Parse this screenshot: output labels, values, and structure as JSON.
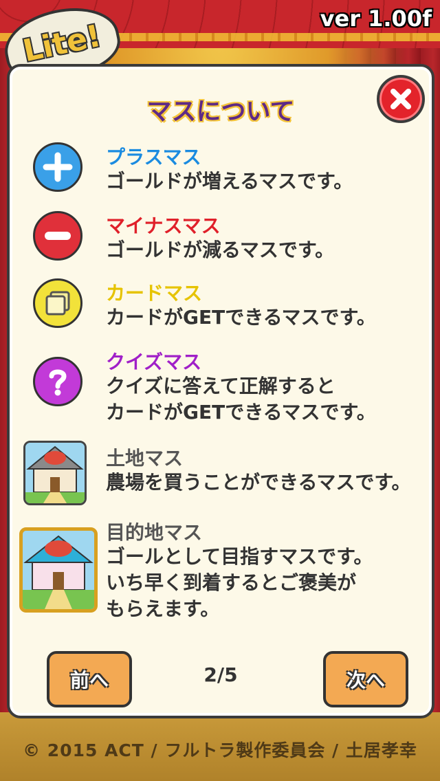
{
  "header": {
    "version": "ver 1.00f",
    "badge": "Lite!"
  },
  "panel": {
    "title": "マスについて",
    "entries": [
      {
        "title": "プラスマス",
        "title_color": "#1a8be0",
        "desc": "ゴールドが増えるマスです。",
        "icon": "plus-icon"
      },
      {
        "title": "マイナスマス",
        "title_color": "#e0202a",
        "desc": "ゴールドが減るマスです。",
        "icon": "minus-icon"
      },
      {
        "title": "カードマス",
        "title_color": "#e6c300",
        "desc": "カードがGETできるマスです。",
        "icon": "card-icon"
      },
      {
        "title": "クイズマス",
        "title_color": "#a020c8",
        "desc": "クイズに答えて正解すると\nカードがGETできるマスです。",
        "icon": "question-icon"
      },
      {
        "title": "土地マス",
        "title_color": "#555555",
        "desc": "農場を買うことができるマスです。",
        "icon": "farm-house-icon"
      },
      {
        "title": "目的地マス",
        "title_color": "#555555",
        "desc": "ゴールとして目指すマスです。\nいち早く到着するとご褒美が\nもらえます。",
        "icon": "goal-house-icon"
      }
    ],
    "nav": {
      "prev": "前へ",
      "next": "次へ",
      "page": "2/5"
    }
  },
  "footer": {
    "copyright": "© 2015 ACT / フルトラ製作委員会 / 土居孝幸"
  }
}
